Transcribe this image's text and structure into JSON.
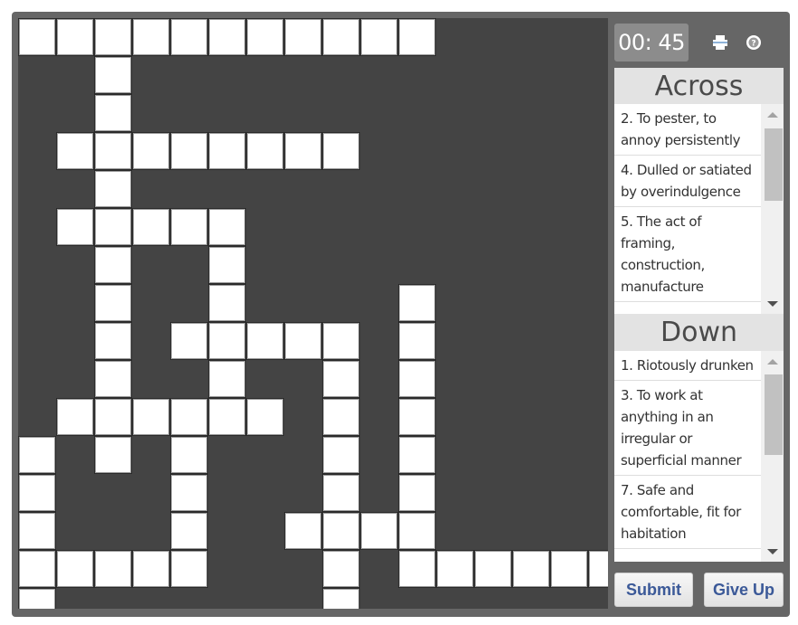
{
  "timer": {
    "display": "00: 45"
  },
  "toolbar": {
    "print_icon": "print-icon",
    "help_icon": "help-icon"
  },
  "colors": {
    "frame": "#666666",
    "grid_bg": "#444444",
    "cell": "#ffffff",
    "button_text": "#3b5998",
    "timer_bg": "#8c8c8c"
  },
  "grid": {
    "cells": [
      [
        0,
        0
      ],
      [
        0,
        1
      ],
      [
        0,
        2
      ],
      [
        0,
        3
      ],
      [
        0,
        4
      ],
      [
        0,
        5
      ],
      [
        0,
        6
      ],
      [
        0,
        7
      ],
      [
        0,
        8
      ],
      [
        0,
        9
      ],
      [
        0,
        10
      ],
      [
        1,
        2
      ],
      [
        2,
        2
      ],
      [
        3,
        1
      ],
      [
        3,
        2
      ],
      [
        3,
        3
      ],
      [
        3,
        4
      ],
      [
        3,
        5
      ],
      [
        3,
        6
      ],
      [
        3,
        7
      ],
      [
        3,
        8
      ],
      [
        4,
        2
      ],
      [
        5,
        1
      ],
      [
        5,
        2
      ],
      [
        5,
        3
      ],
      [
        5,
        4
      ],
      [
        5,
        5
      ],
      [
        6,
        2
      ],
      [
        6,
        5
      ],
      [
        7,
        2
      ],
      [
        7,
        5
      ],
      [
        7,
        10
      ],
      [
        8,
        2
      ],
      [
        8,
        4
      ],
      [
        8,
        5
      ],
      [
        8,
        6
      ],
      [
        8,
        7
      ],
      [
        8,
        8
      ],
      [
        8,
        10
      ],
      [
        9,
        2
      ],
      [
        9,
        5
      ],
      [
        9,
        8
      ],
      [
        9,
        10
      ],
      [
        10,
        1
      ],
      [
        10,
        2
      ],
      [
        10,
        3
      ],
      [
        10,
        4
      ],
      [
        10,
        5
      ],
      [
        10,
        6
      ],
      [
        10,
        8
      ],
      [
        10,
        10
      ],
      [
        11,
        0
      ],
      [
        11,
        2
      ],
      [
        11,
        4
      ],
      [
        11,
        8
      ],
      [
        11,
        10
      ],
      [
        12,
        0
      ],
      [
        12,
        4
      ],
      [
        12,
        8
      ],
      [
        12,
        10
      ],
      [
        13,
        0
      ],
      [
        13,
        4
      ],
      [
        13,
        7
      ],
      [
        13,
        8
      ],
      [
        13,
        9
      ],
      [
        13,
        10
      ],
      [
        14,
        0
      ],
      [
        14,
        1
      ],
      [
        14,
        2
      ],
      [
        14,
        3
      ],
      [
        14,
        4
      ],
      [
        14,
        8
      ],
      [
        14,
        10
      ],
      [
        14,
        11
      ],
      [
        14,
        12
      ],
      [
        14,
        13
      ],
      [
        14,
        14
      ],
      [
        14,
        15
      ],
      [
        15,
        0
      ],
      [
        15,
        8
      ]
    ]
  },
  "across": {
    "title": "Across",
    "clues": [
      {
        "label": "2. To pester, to annoy persistently"
      },
      {
        "label": "4. Dulled or satiated by overindulgence"
      },
      {
        "label": "5. The act of framing, construction, manufacture"
      }
    ]
  },
  "down": {
    "title": "Down",
    "clues": [
      {
        "label": "1. Riotously drunken"
      },
      {
        "label": "3. To work at anything in an irregular or superficial manner"
      },
      {
        "label": "7. Safe and comfortable, fit for habitation"
      }
    ]
  },
  "buttons": {
    "submit": "Submit",
    "give_up": "Give Up"
  }
}
